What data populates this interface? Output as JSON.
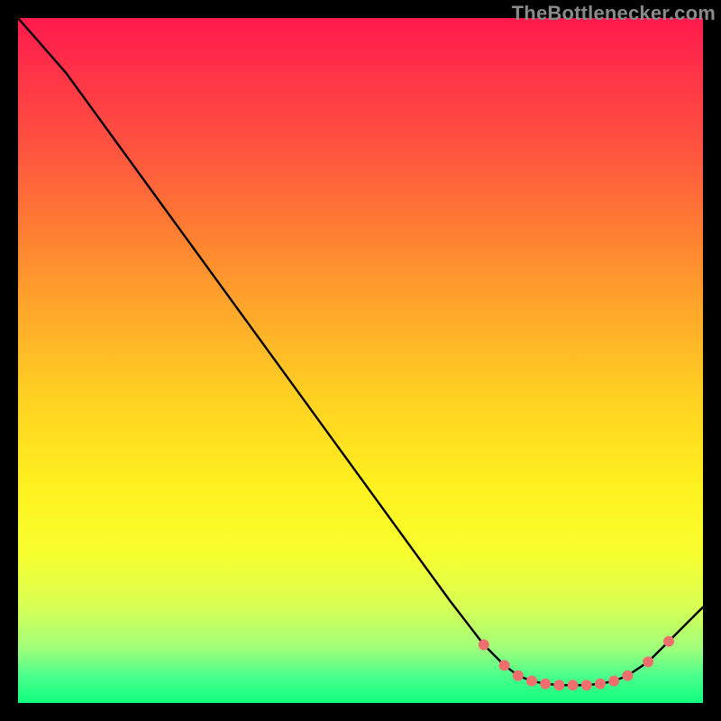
{
  "watermark": "TheBottlenecker.com",
  "colors": {
    "curve": "#000000",
    "marker": "#ef6f6f",
    "background_top": "#ff1a4d",
    "background_bottom": "#0fff7f"
  },
  "chart_data": {
    "type": "line",
    "title": "",
    "xlabel": "",
    "ylabel": "",
    "xlim": [
      0,
      100
    ],
    "ylim": [
      0,
      100
    ],
    "x": [
      0,
      7,
      15,
      23,
      31,
      39,
      47,
      55,
      63,
      68,
      71,
      73,
      75,
      77,
      79,
      81,
      83,
      85,
      87,
      89,
      92,
      95,
      100
    ],
    "values": [
      100,
      92,
      81,
      70,
      59,
      48,
      37,
      26,
      15,
      8.5,
      5.5,
      4,
      3.2,
      2.8,
      2.6,
      2.6,
      2.6,
      2.8,
      3.2,
      4,
      6,
      9,
      14
    ],
    "markers": {
      "x": [
        68,
        71,
        73,
        75,
        77,
        79,
        81,
        83,
        85,
        87,
        89,
        92,
        95
      ],
      "y": [
        8.5,
        5.5,
        4,
        3.2,
        2.8,
        2.6,
        2.6,
        2.6,
        2.8,
        3.2,
        4,
        6,
        9
      ]
    }
  }
}
